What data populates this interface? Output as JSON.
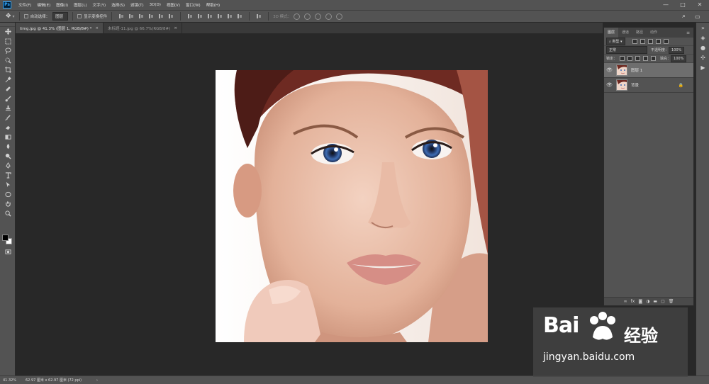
{
  "menubar": {
    "items": [
      "文件(F)",
      "编辑(E)",
      "图像(I)",
      "图层(L)",
      "文字(Y)",
      "选择(S)",
      "滤镜(T)",
      "3D(D)",
      "视图(V)",
      "窗口(W)",
      "帮助(H)"
    ],
    "win_min": "—",
    "win_max": "□",
    "win_close": "✕"
  },
  "options": {
    "auto_select_label": "自动选择：",
    "auto_select_value": "图层",
    "show_transform_label": "显示变换控件",
    "mode_3d_label": "3D 模式："
  },
  "tabs": [
    {
      "label": "timg.jpg @ 41.3% (图层 1, RGB/8#) *",
      "close": "×"
    },
    {
      "label": "未标题-11.jpg @ 66.7%(RGB/8#)",
      "close": "×"
    }
  ],
  "layers_panel": {
    "tabs": [
      "图层",
      "通道",
      "路径",
      "动作"
    ],
    "kind_label": "类型",
    "blend_mode": "正常",
    "opacity_label": "不透明度：",
    "opacity_value": "100%",
    "lock_label": "锁定：",
    "fill_label": "填充：",
    "fill_value": "100%",
    "layers": [
      {
        "name": "图层 1",
        "selected": true,
        "locked": false
      },
      {
        "name": "背景",
        "selected": false,
        "locked": true
      }
    ],
    "bottom_icons": [
      "∞",
      "fx"
    ]
  },
  "statusbar": {
    "zoom": "41.32%",
    "doc_size": "62.97 厘米 x 62.97 厘米 (72 ppi)",
    "arrow": "›"
  },
  "watermark": {
    "brand": "Bai",
    "brand_cn": "经验",
    "url": "jingyan.baidu.com"
  }
}
